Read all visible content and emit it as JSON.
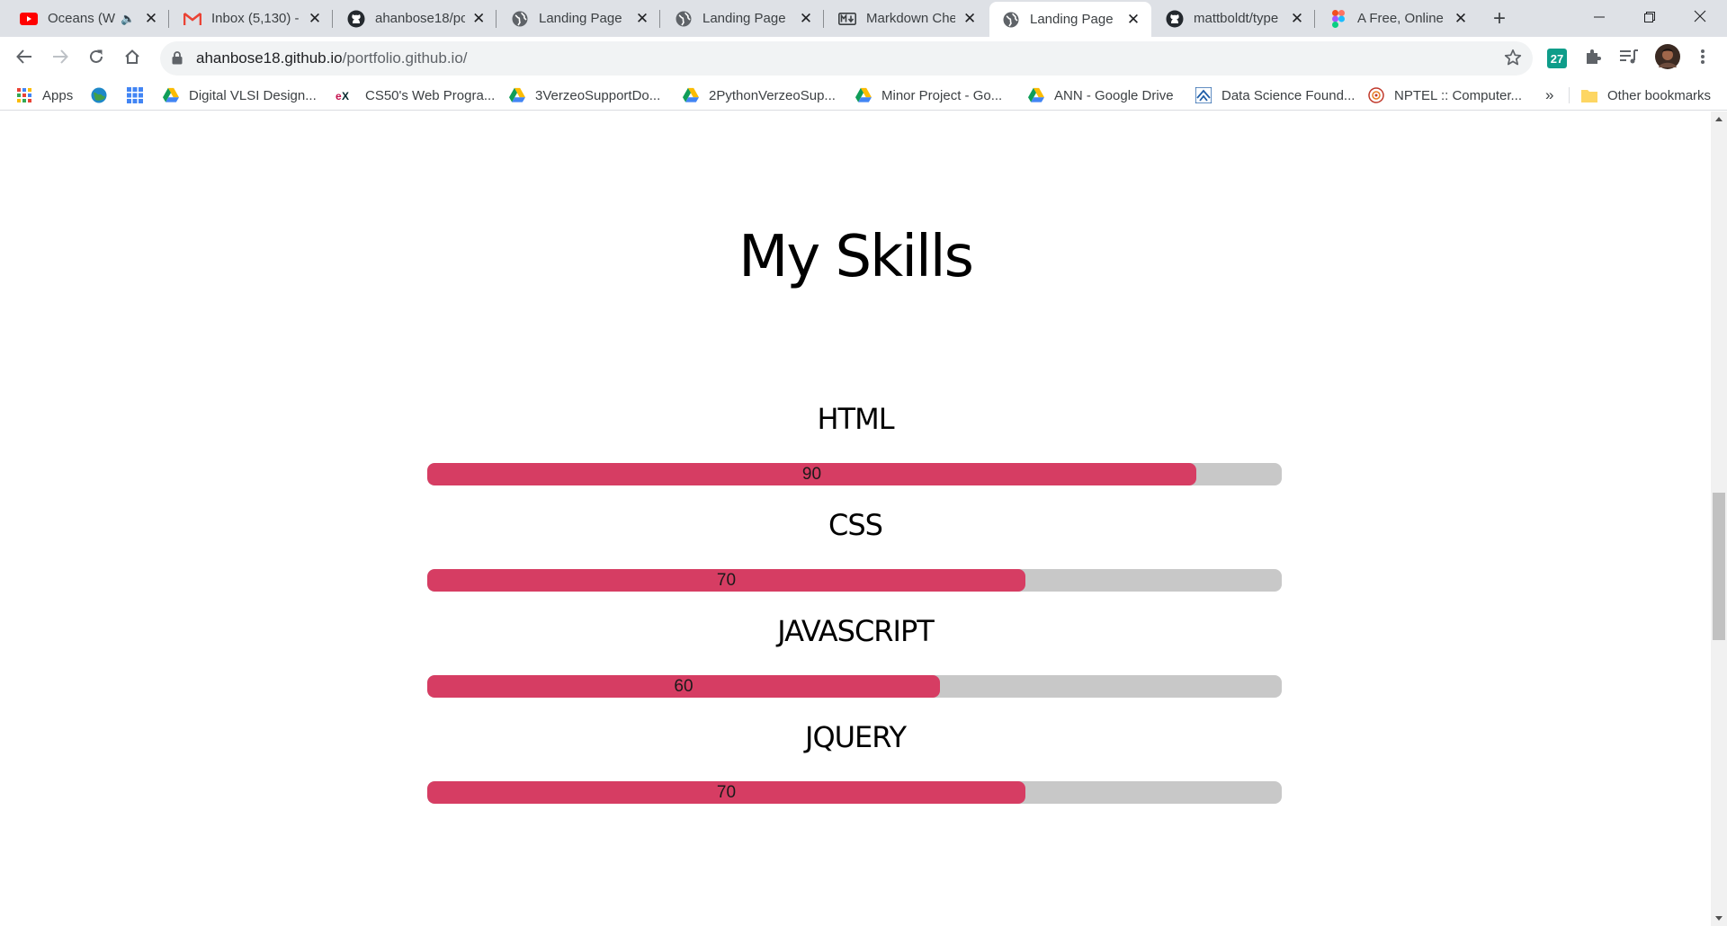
{
  "browser": {
    "tabs": [
      {
        "title": "Oceans (W",
        "icon": "youtube-icon",
        "audio": true
      },
      {
        "title": "Inbox (5,130) -",
        "icon": "gmail-icon"
      },
      {
        "title": "ahanbose18/pc",
        "icon": "github-icon"
      },
      {
        "title": "Landing Page",
        "icon": "globe-icon"
      },
      {
        "title": "Landing Page",
        "icon": "globe-icon"
      },
      {
        "title": "Markdown Che",
        "icon": "markdown-icon"
      },
      {
        "title": "Landing Page",
        "icon": "globe-icon",
        "active": true
      },
      {
        "title": "mattboldt/type",
        "icon": "github-icon"
      },
      {
        "title": "A Free, Online",
        "icon": "figma-icon"
      }
    ],
    "url": {
      "host": "ahanbose18.github.io",
      "path": "/portfolio.github.io/"
    },
    "extension_badge": "27",
    "bookmarks": [
      {
        "label": "Apps",
        "icon": "apps-grid-icon"
      },
      {
        "label": "",
        "icon": "globe-bookmark-icon"
      },
      {
        "label": "",
        "icon": "google-apps-icon"
      },
      {
        "label": "Digital VLSI Design...",
        "icon": "google-drive-icon"
      },
      {
        "label": "CS50's Web Progra...",
        "icon": "edx-icon"
      },
      {
        "label": "3VerzeoSupportDo...",
        "icon": "google-drive-icon"
      },
      {
        "label": "2PythonVerzeoSup...",
        "icon": "google-drive-icon"
      },
      {
        "label": "Minor Project - Go...",
        "icon": "google-drive-icon"
      },
      {
        "label": "ANN - Google Drive",
        "icon": "google-drive-icon"
      },
      {
        "label": "Data Science Found...",
        "icon": "coursera-icon"
      },
      {
        "label": "NPTEL :: Computer...",
        "icon": "nptel-icon"
      }
    ],
    "more_bookmarks": "»",
    "other_bookmarks": "Other bookmarks"
  },
  "page": {
    "title": "My Skills",
    "skills": [
      {
        "name": "HTML",
        "value": 90,
        "text": "90"
      },
      {
        "name": "CSS",
        "value": 70,
        "text": "70"
      },
      {
        "name": "JAVASCRIPT",
        "value": 60,
        "text": "60"
      },
      {
        "name": "JQUERY",
        "value": 70,
        "text": "70"
      }
    ]
  },
  "colors": {
    "bar_fill": "#d63d63",
    "bar_track": "#c8c8c8"
  }
}
